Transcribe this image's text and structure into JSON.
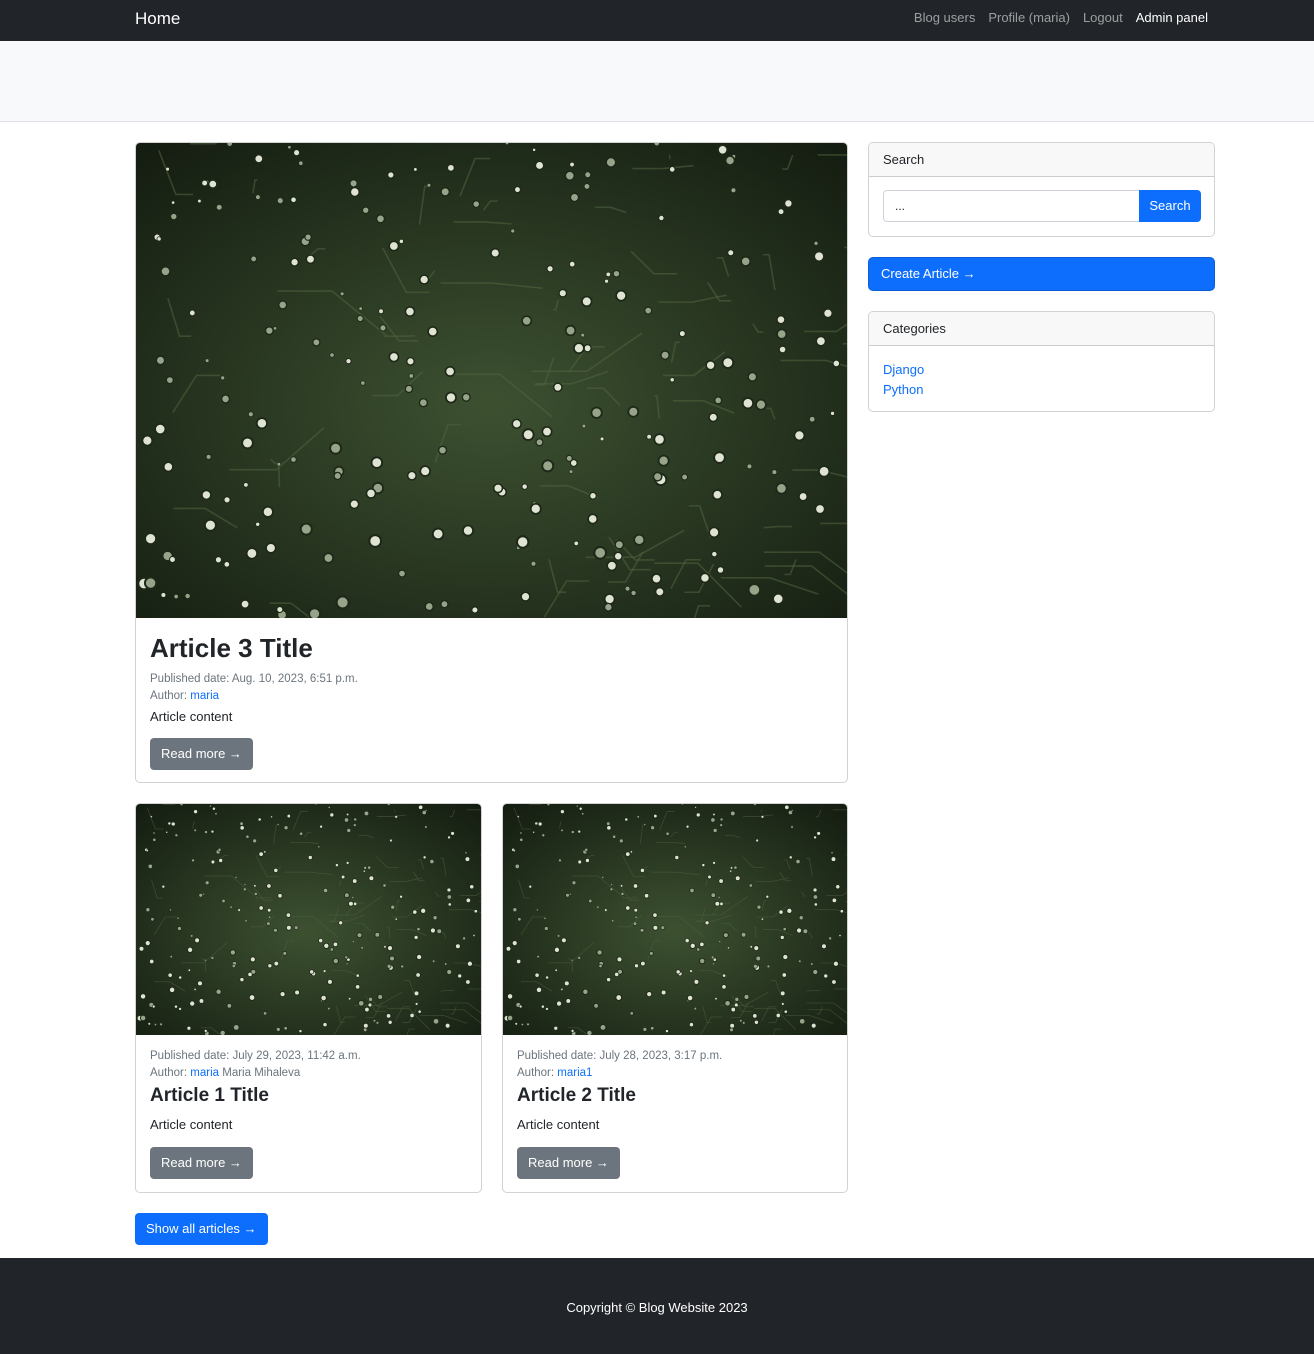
{
  "navbar": {
    "brand": "Home",
    "links": [
      {
        "label": "Blog users"
      },
      {
        "label": "Profile (maria)"
      },
      {
        "label": "Logout"
      },
      {
        "label": "Admin panel"
      }
    ]
  },
  "featured": {
    "title": "Article 3 Title",
    "published": "Published date: Aug. 10, 2023, 6:51 p.m.",
    "author_label": "Author:",
    "author_link": "maria",
    "content": "Article content",
    "read_more": "Read more →"
  },
  "articles": [
    {
      "published": "Published date: July 29, 2023, 11:42 a.m.",
      "author_label": "Author:",
      "author_link": "maria",
      "author_name": "Maria Mihaleva",
      "title": "Article 1 Title",
      "content": "Article content",
      "read_more": "Read more →"
    },
    {
      "published": "Published date: July 28, 2023, 3:17 p.m.",
      "author_label": "Author:",
      "author_link": "maria1",
      "author_name": "",
      "title": "Article 2 Title",
      "content": "Article content",
      "read_more": "Read more →"
    }
  ],
  "show_all": "Show all articles →",
  "sidebar": {
    "search": {
      "header": "Search",
      "input_value": "...",
      "button": "Search"
    },
    "create_article": "Create Article →",
    "categories": {
      "header": "Categories",
      "items": [
        "Django",
        "Python"
      ]
    }
  },
  "footer": {
    "copyright": "Copyright © Blog Website 2023"
  },
  "colors": {
    "navbar_bg": "#212529",
    "primary": "#0d6efd",
    "secondary": "#6c757d",
    "pcb_green": "#2c3a24"
  }
}
